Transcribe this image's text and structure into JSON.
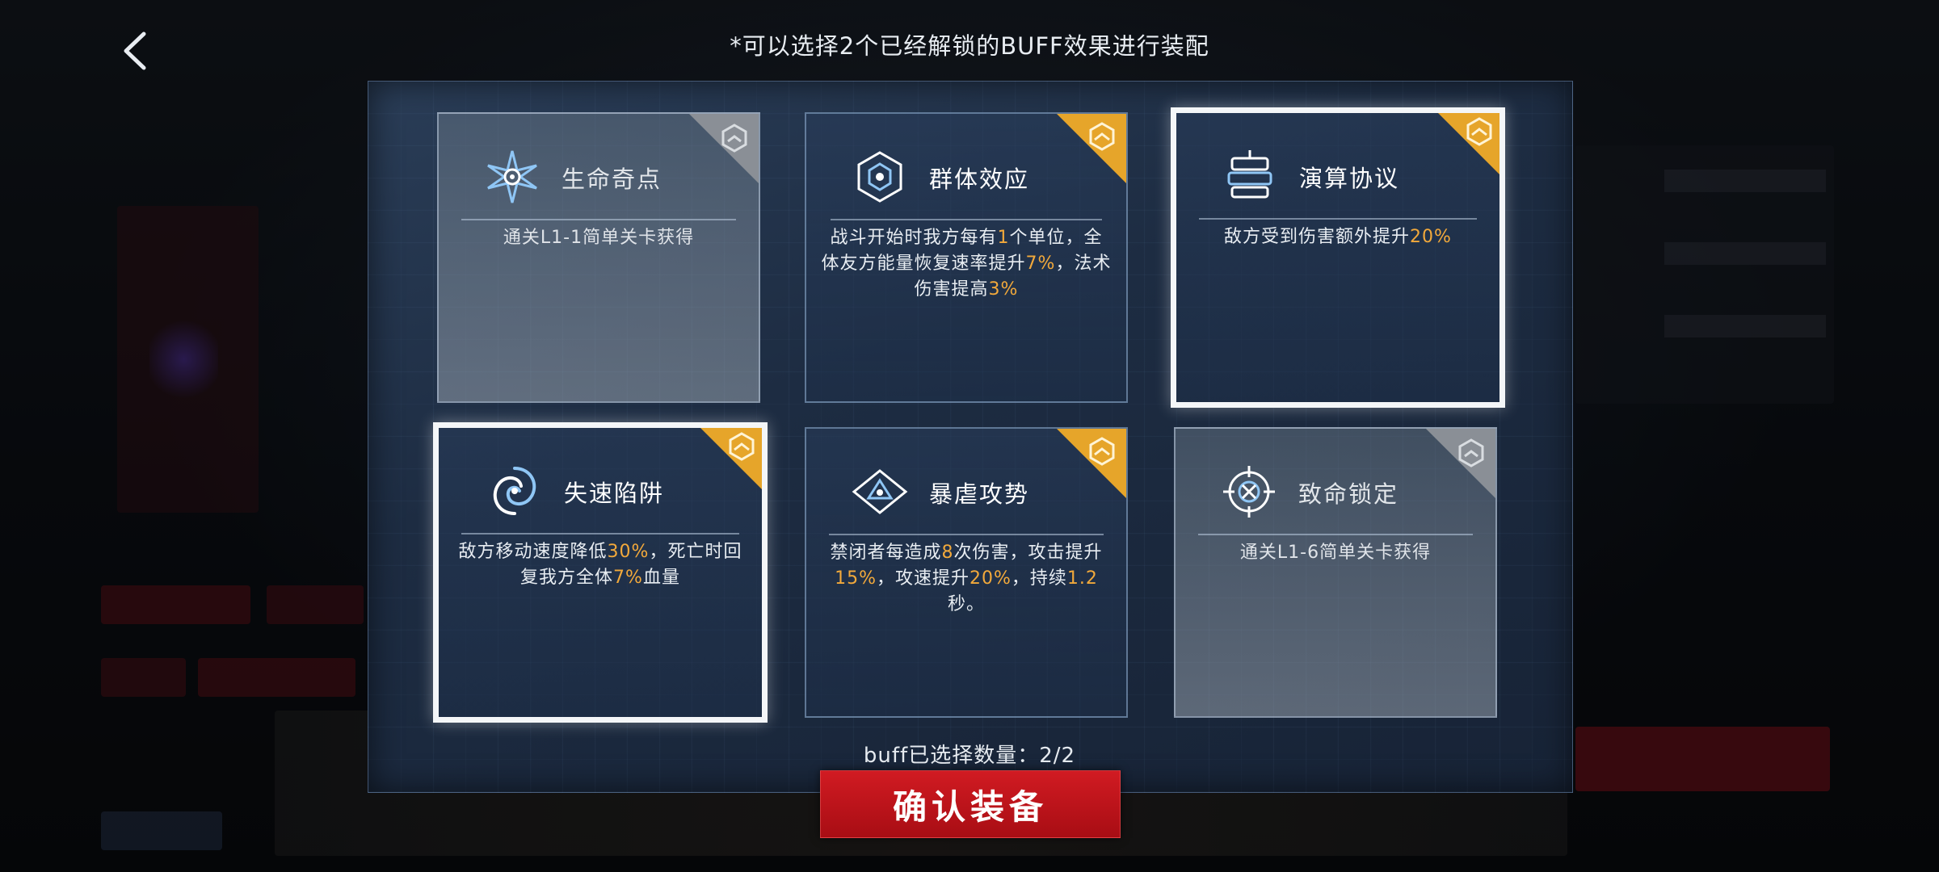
{
  "header": {
    "hint": "*可以选择2个已经解锁的BUFF效果进行装配"
  },
  "cards": [
    {
      "id": "life-singularity",
      "title": "生命奇点",
      "state": "locked",
      "icon": "star-burst-icon",
      "desc_parts": [
        {
          "t": "通关L1-1简单关卡获得"
        }
      ]
    },
    {
      "id": "swarm-effect",
      "title": "群体效应",
      "state": "unlocked",
      "icon": "hexagon-core-icon",
      "desc_parts": [
        {
          "t": "战斗开始时我方每有"
        },
        {
          "t": "1",
          "hl": true
        },
        {
          "t": "个单位，全体友方能量恢复速率提升"
        },
        {
          "t": "7%",
          "hl": true
        },
        {
          "t": "，法术伤害提高"
        },
        {
          "t": "3%",
          "hl": true
        }
      ]
    },
    {
      "id": "calculation-protocol",
      "title": "演算协议",
      "state": "selected",
      "icon": "server-stack-icon",
      "desc_parts": [
        {
          "t": "敌方受到伤害额外提升"
        },
        {
          "t": "20%",
          "hl": true
        }
      ]
    },
    {
      "id": "slow-trap",
      "title": "失速陷阱",
      "state": "selected",
      "icon": "vortex-icon",
      "desc_parts": [
        {
          "t": "敌方移动速度降低"
        },
        {
          "t": "30%",
          "hl": true
        },
        {
          "t": "，死亡时回复我方全体"
        },
        {
          "t": "7%",
          "hl": true
        },
        {
          "t": "血量"
        }
      ]
    },
    {
      "id": "tyrant-offensive",
      "title": "暴虐攻势",
      "state": "unlocked",
      "icon": "eye-triangle-icon",
      "desc_parts": [
        {
          "t": "禁闭者每造成"
        },
        {
          "t": "8",
          "hl": true
        },
        {
          "t": "次伤害，攻击提升"
        },
        {
          "t": "15%",
          "hl": true
        },
        {
          "t": "，攻速提升"
        },
        {
          "t": "20%",
          "hl": true
        },
        {
          "t": "，持续"
        },
        {
          "t": "1.2",
          "hl": true
        },
        {
          "t": "秒。"
        }
      ]
    },
    {
      "id": "fatal-lock",
      "title": "致命锁定",
      "state": "locked",
      "icon": "crosshair-icon",
      "desc_parts": [
        {
          "t": "通关L1-6简单关卡获得"
        }
      ]
    }
  ],
  "footer": {
    "count_label": "buff已选择数量：2/2",
    "confirm_label": "确认装备"
  },
  "colors": {
    "highlight": "#f2a93b",
    "rank_gold": "#e6a52a",
    "rank_grey": "#8a8f96",
    "confirm_red": "#c8141c"
  }
}
